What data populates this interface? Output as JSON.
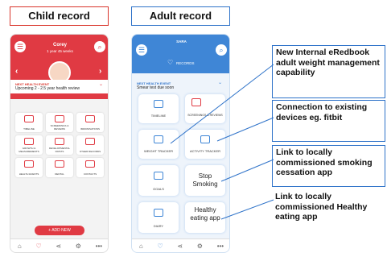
{
  "headers": {
    "child": "Child record",
    "adult": "Adult record"
  },
  "child_phone": {
    "name": "Corey",
    "age": "1 year 45 weeks",
    "event_label": "NEXT HEALTH EVENT",
    "event_text": "Upcoming 2 - 2.5 year health review",
    "tiles": [
      "TIMELINE",
      "SCREENINGS & REVIEWS",
      "IMMUNISATIONS",
      "GROWTH & MEASUREMENTS",
      "DEVELOPMENTAL FIRSTS",
      "OTHER RECORDS",
      "HEALTH EVENTS",
      "DENTAL",
      "CONTACTS"
    ],
    "add_label": "+ ADD NEW"
  },
  "adult_phone": {
    "name": "SARA",
    "records_label": "RECORDS",
    "event_label": "NEXT HEALTH EVENT",
    "event_text": "Smear test due soon",
    "tiles": {
      "timeline": "TIMELINE",
      "screenings": "SCREENINGS & REVIEWS",
      "weight": "WEIGHT TRACKER",
      "activity": "ACTIVITY TRACKER",
      "goals": "GOALS",
      "smoking": "Stop Smoking",
      "diary": "DIARY",
      "healthy": "Healthy eating app"
    }
  },
  "callouts": [
    "New Internal eRedbook adult weight management capability",
    "Connection to existing devices eg. fitbit",
    "Link to locally commissioned smoking cessation app",
    "Link to locally commissioned Healthy eating app"
  ],
  "colors": {
    "child_accent": "#e03a43",
    "adult_accent": "#3f86d6",
    "callout_line": "#2f73c9"
  }
}
